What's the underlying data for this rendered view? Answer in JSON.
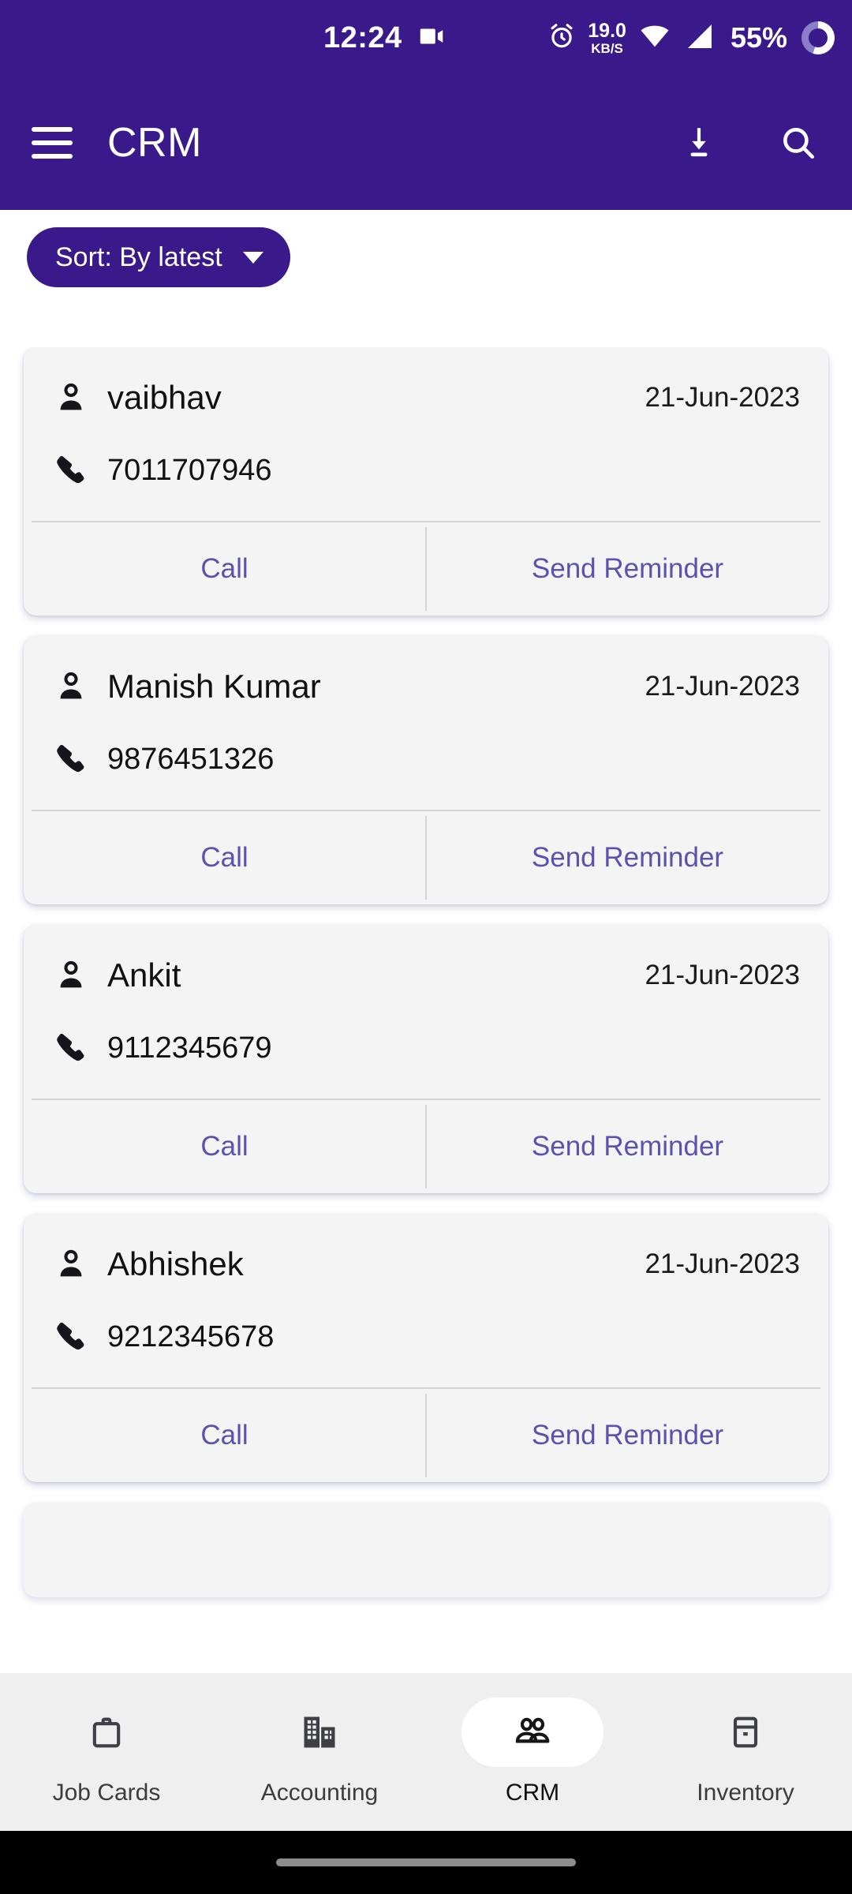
{
  "status_bar": {
    "time": "12:24",
    "screen_record_icon": "video-camera-icon",
    "alarm_icon": "alarm-clock-icon",
    "network_speed_value": "19.0",
    "network_speed_unit": "KB/S",
    "wifi_icon": "wifi-icon",
    "signal_icon": "cellular-signal-icon",
    "battery_percent": "55%",
    "battery_icon": "battery-ring-icon"
  },
  "app_bar": {
    "menu_icon": "hamburger-menu-icon",
    "title": "CRM",
    "download_label": "download-icon",
    "search_label": "search-icon"
  },
  "sort": {
    "label": "Sort: By latest",
    "caret": "chevron-down-icon"
  },
  "actions": {
    "call": "Call",
    "send_reminder": "Send Reminder"
  },
  "contacts": [
    {
      "name": "vaibhav",
      "date": "21-Jun-2023",
      "phone": "7011707946"
    },
    {
      "name": "Manish Kumar",
      "date": "21-Jun-2023",
      "phone": "9876451326"
    },
    {
      "name": "Ankit",
      "date": "21-Jun-2023",
      "phone": "9112345679"
    },
    {
      "name": "Abhishek",
      "date": "21-Jun-2023",
      "phone": "9212345678"
    }
  ],
  "bottom_nav": {
    "items": [
      {
        "label": "Job Cards",
        "icon": "briefcase-icon",
        "active": false
      },
      {
        "label": "Accounting",
        "icon": "building-icon",
        "active": false
      },
      {
        "label": "CRM",
        "icon": "people-icon",
        "active": true
      },
      {
        "label": "Inventory",
        "icon": "archive-box-icon",
        "active": false
      }
    ]
  },
  "colors": {
    "brand_purple": "#3A1A8B",
    "action_link": "#5B52AE",
    "card_bg": "#F4F4F5",
    "nav_bg": "#EFEFEF",
    "page_bg": "#FFFFFF"
  }
}
